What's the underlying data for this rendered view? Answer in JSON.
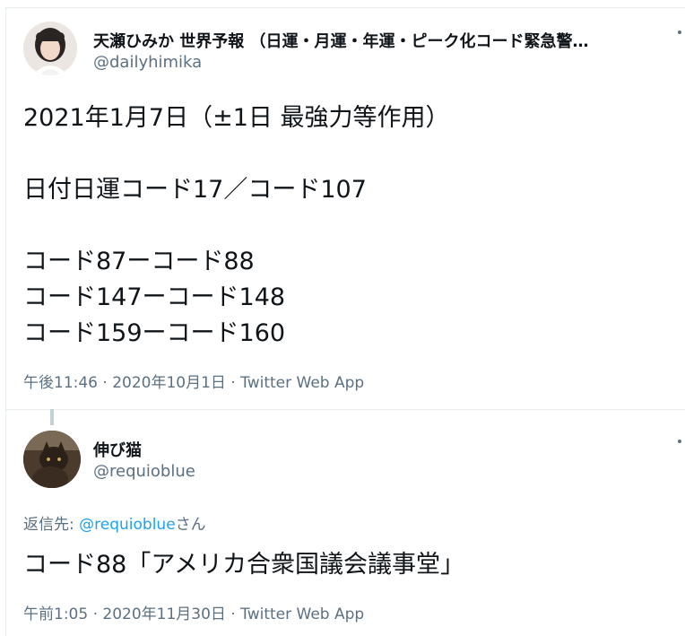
{
  "tweet1": {
    "display_name": "天瀬ひみか 世界予報 （日運・月運・年運・ピーク化コード緊急警…",
    "handle": "@dailyhimika",
    "more_icon": "more-dots-icon",
    "text": "2021年1月7日（±1日 最強力等作用）\n\n日付日運コード17／コード107\n\nコード87ーコード88\nコード147ーコード148\nコード159ーコード160",
    "time": "午後11:46",
    "date": "2020年10月1日",
    "source": "Twitter Web App",
    "separator": "·"
  },
  "tweet2": {
    "display_name": "伸び猫",
    "handle": "@requioblue",
    "more_icon": "more-dots-icon",
    "reply_prefix": "返信先: ",
    "reply_handle": "@requioblue",
    "reply_suffix": "さん",
    "text": "コード88「アメリカ合衆国議会議事堂」",
    "time": "午前1:05",
    "date": "2020年11月30日",
    "source": "Twitter Web App",
    "separator": "·"
  }
}
